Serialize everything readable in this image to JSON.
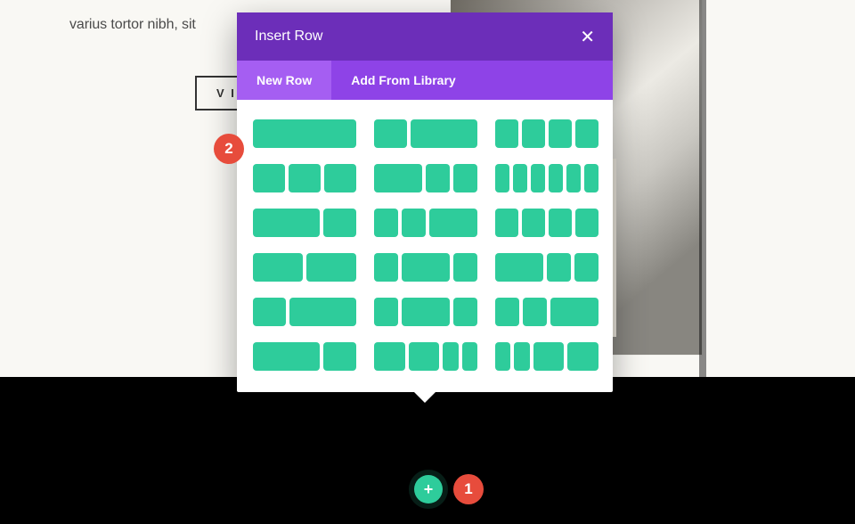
{
  "page": {
    "text_fragment": "varius tortor nibh, sit",
    "button_partial": "V I"
  },
  "modal": {
    "title": "Insert Row",
    "close_glyph": "✕",
    "tabs": {
      "new_row": "New Row",
      "add_library": "Add From Library"
    }
  },
  "add_button": {
    "glyph": "+"
  },
  "annotations": {
    "step1": "1",
    "step2": "2"
  },
  "layouts": [
    [
      12
    ],
    [
      4,
      8
    ],
    [
      3,
      3,
      3,
      3
    ],
    [
      4,
      4,
      4
    ],
    [
      6,
      3,
      3
    ],
    [
      2,
      2,
      2,
      2,
      2,
      2
    ],
    [
      8,
      4
    ],
    [
      3,
      3,
      6
    ],
    [
      3,
      3,
      3,
      3
    ],
    [
      6,
      6
    ],
    [
      3,
      6,
      3
    ],
    [
      6,
      3,
      3
    ],
    [
      4,
      8
    ],
    [
      3,
      6,
      3
    ],
    [
      3,
      3,
      6
    ],
    [
      8,
      4
    ],
    [
      4,
      4,
      2,
      2
    ],
    [
      2,
      2,
      4,
      4
    ]
  ]
}
